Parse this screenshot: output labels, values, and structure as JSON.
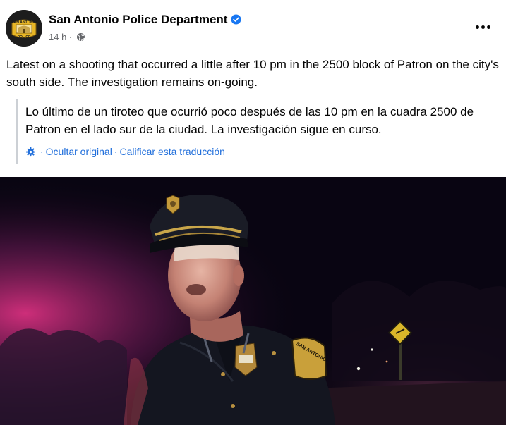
{
  "post": {
    "author": "San Antonio Police Department",
    "timestamp": "14 h ·",
    "verified_icon": "verified-badge-icon",
    "privacy_icon": "globe-icon",
    "more_icon": "more-options-icon",
    "caption": "Latest on a shooting that occurred a little after 10 pm in the 2500 block of Patron on the city's south side. The investigation remains on-going.",
    "translation": {
      "text": "Lo último de un tiroteo que ocurrió poco después de las 10 pm en la cuadra 2500 de Patron en el lado sur de la ciudad. La investigación sigue en curso.",
      "hide_original": "Ocultar original",
      "rate_translation": "Calificar esta traducción",
      "separator": "·"
    },
    "avatar": {
      "top_text": "SAN ANTONIO",
      "bottom_text": "POLICE"
    },
    "media": {
      "type": "video-thumbnail",
      "badge_text": "SAN ANTONIO"
    }
  },
  "colors": {
    "link": "#216fdb",
    "verified": "#1877f2",
    "secondary_text": "#65676b",
    "night_sky": "#090512",
    "neon_pink": "#d4287a"
  }
}
